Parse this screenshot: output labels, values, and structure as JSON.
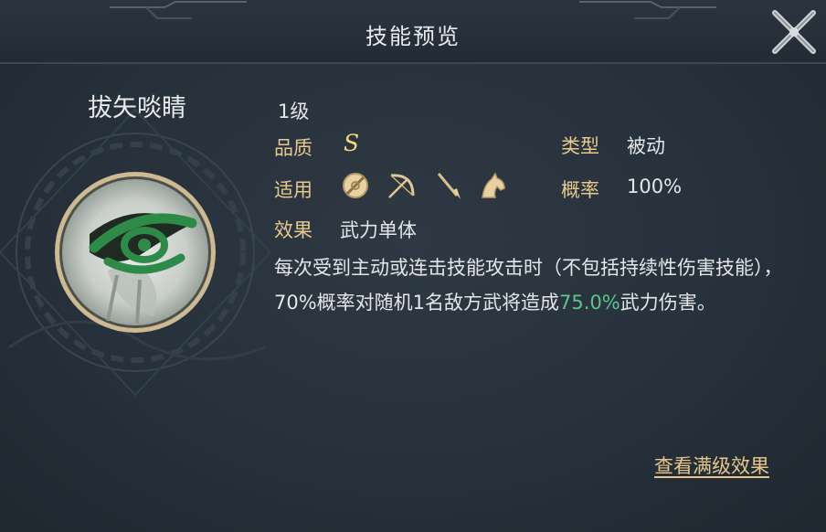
{
  "header": {
    "title": "技能预览"
  },
  "skill": {
    "name": "拔矢啖睛",
    "level": "1级",
    "quality_label": "品质",
    "quality_value": "S",
    "type_label": "类型",
    "type_value": "被动",
    "apply_label": "适用",
    "apply_icons": [
      "shield-icon",
      "bow-icon",
      "spear-icon",
      "horse-icon"
    ],
    "rate_label": "概率",
    "rate_value": "100%",
    "effect_label": "效果",
    "effect_value": "武力单体",
    "desc_part1": "每次受到主动或连击技能攻击时（不包括持续性伤害技能），70%概率对随机1名敌方武将造成",
    "desc_highlight": "75.0%",
    "desc_part2": "武力伤害。"
  },
  "footer": {
    "view_max_label": "查看满级效果"
  },
  "colors": {
    "label": "#e7c98e",
    "highlight": "#5cc48c",
    "grade": "#f4d77a"
  }
}
